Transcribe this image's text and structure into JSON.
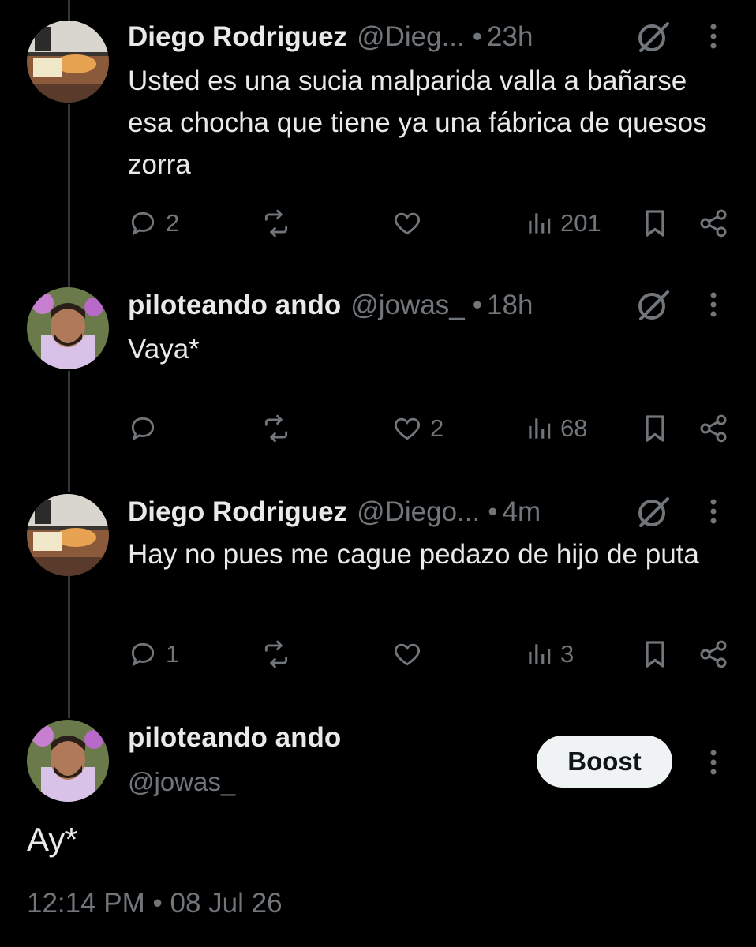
{
  "thread": [
    {
      "name": "Diego Rodriguez",
      "handle": "@Dieg...",
      "dot": "•",
      "time": "23h",
      "text": "Usted es una sucia malparida valla a bañarse esa chocha que tiene ya una fábrica de quesos zorra",
      "replies": "2",
      "reposts": "",
      "likes": "",
      "views": "201"
    },
    {
      "name": "piloteando ando",
      "handle": "@jowas_",
      "dot": "•",
      "time": "18h",
      "text": "Vaya*",
      "replies": "",
      "reposts": "",
      "likes": "2",
      "views": "68"
    },
    {
      "name": "Diego Rodriguez",
      "handle": "@Diego...",
      "dot": "•",
      "time": "4m",
      "text": "Hay no pues me cague pedazo de hijo de puta",
      "replies": "1",
      "reposts": "",
      "likes": "",
      "views": "3"
    }
  ],
  "main_post": {
    "name": "piloteando ando",
    "handle": "@jowas_",
    "boost_label": "Boost",
    "text": "Ay*",
    "timestamp": "12:14 PM • 08 Jul 26"
  },
  "icons": {
    "reply": "reply-icon",
    "repost": "repost-icon",
    "like": "heart-icon",
    "views": "views-chart-icon",
    "bookmark": "bookmark-icon",
    "share": "share-icon",
    "grok": "grok-icon",
    "more": "more-vertical-icon"
  },
  "colors": {
    "background": "#000000",
    "text": "#e7e9ea",
    "muted": "#71767b",
    "thread_line": "#333639",
    "button_bg": "#eff3f4"
  }
}
